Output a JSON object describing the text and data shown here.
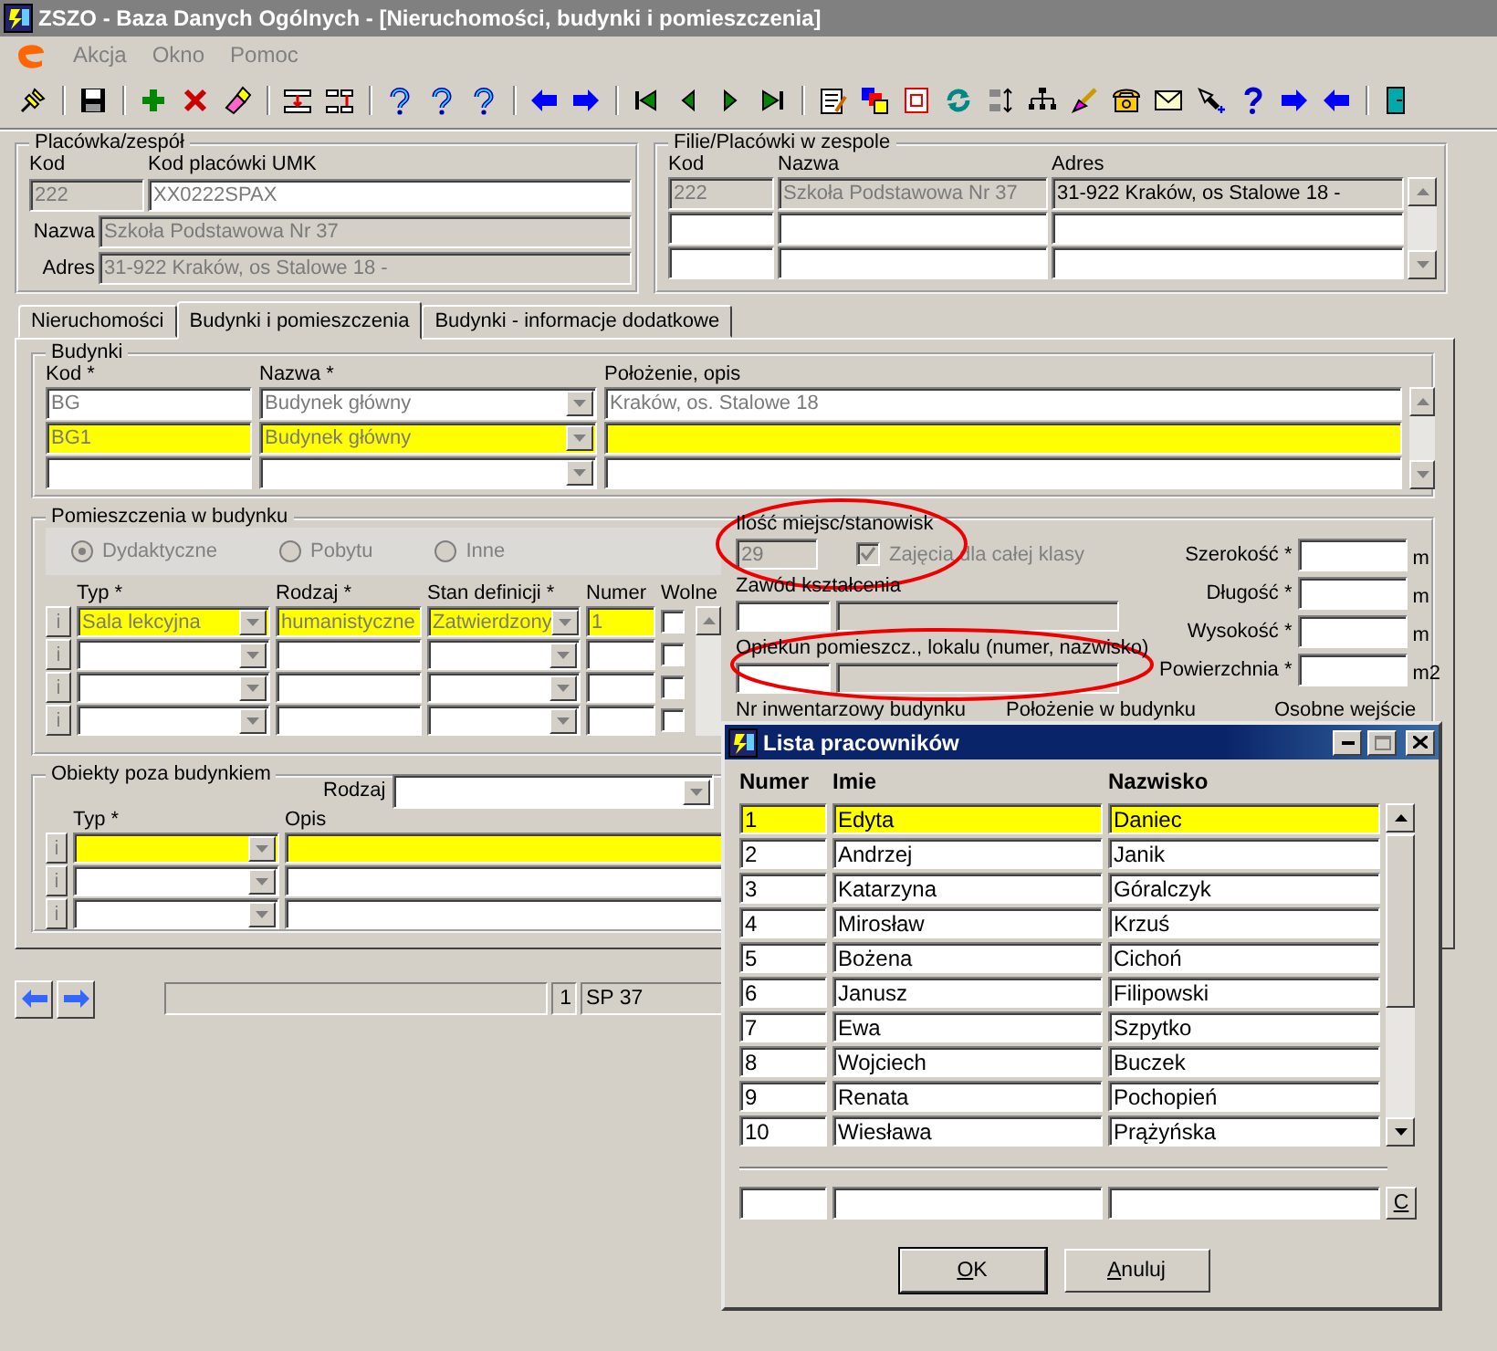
{
  "window": {
    "title": "ZSZO - Baza Danych Ogólnych - [Nieruchomości, budynki i pomieszczenia]"
  },
  "menu": [
    {
      "label": "Akcja",
      "disabled": true
    },
    {
      "label": "Okno",
      "disabled": true
    },
    {
      "label": "Pomoc",
      "disabled": true
    }
  ],
  "placowka": {
    "title": "Placówka/zespół",
    "kod_label": "Kod",
    "kod": "222",
    "umk_label": "Kod placówki UMK",
    "umk": "XX0222SPAX",
    "nazwa_label": "Nazwa",
    "nazwa": "Szkoła Podstawowa Nr  37",
    "adres_label": "Adres",
    "adres": "31-922 Kraków, os Stalowe 18 -"
  },
  "filie": {
    "title": "Filie/Placówki w zespole",
    "columns": [
      "Kod",
      "Nazwa",
      "Adres"
    ],
    "rows": [
      {
        "kod": "222",
        "nazwa": "Szkoła Podstawowa Nr  37",
        "adres": "31-922 Kraków, os Stalowe 18 -"
      },
      {},
      {}
    ]
  },
  "tabs": [
    {
      "label": "Nieruchomości",
      "selected": false
    },
    {
      "label": "Budynki i pomieszczenia",
      "selected": true
    },
    {
      "label": "Budynki - informacje dodatkowe",
      "selected": false
    }
  ],
  "budynki": {
    "title": "Budynki",
    "columns": [
      "Kod *",
      "Nazwa *",
      "Położenie, opis"
    ],
    "rows": [
      {
        "kod": "BG",
        "nazwa": "Budynek główny",
        "opis": "Kraków, os. Stalowe 18",
        "selected": false
      },
      {
        "kod": "BG1",
        "nazwa": "Budynek główny",
        "selected": true
      },
      {
        "selected": false
      }
    ]
  },
  "pomieszczenia": {
    "title": "Pomieszczenia w budynku",
    "radios": [
      {
        "label": "Dydaktyczne",
        "selected": true,
        "disabled": true
      },
      {
        "label": "Pobytu",
        "selected": false,
        "disabled": true
      },
      {
        "label": "Inne",
        "selected": false,
        "disabled": true
      }
    ],
    "columns": [
      "Typ *",
      "Rodzaj *",
      "Stan definicji *",
      "Numer",
      "Wolne"
    ],
    "rows": [
      {
        "info": "i",
        "typ": "Sala lekcyjna",
        "rodzaj": "humanistyczne",
        "stan": "Zatwierdzony",
        "numer": "1",
        "wolne": false,
        "selected": true
      },
      {
        "info": "i",
        "wolne": false,
        "selected": false
      },
      {
        "info": "i",
        "wolne": false,
        "selected": false
      },
      {
        "info": "i",
        "wolne": false,
        "selected": false
      }
    ],
    "miejsca_label": "Ilość miejsc/stanowisk",
    "miejsca": "29",
    "cala_klasa": {
      "label": "Zajęcia dla całej klasy",
      "checked": true,
      "disabled": true
    },
    "zawod_label": "Zawód kształcenia",
    "opiekun_label": "Opiekun pomieszcz., lokalu (numer, nazwisko)",
    "dims": [
      {
        "label": "Szerokość *",
        "unit": "m"
      },
      {
        "label": "Długość *",
        "unit": "m"
      },
      {
        "label": "Wysokość *",
        "unit": "m"
      },
      {
        "label": "Powierzchnia *",
        "unit": "m2"
      }
    ],
    "bottom_labels": [
      "Nr inwentarzowy budynku",
      "Położenie w budynku",
      "Osobne wejście"
    ]
  },
  "obiekty": {
    "title": "Obiekty poza budynkiem",
    "rodzaj_label": "Rodzaj",
    "columns": [
      "Typ *",
      "Opis"
    ],
    "rows": [
      {
        "info": "i",
        "selected": true
      },
      {
        "info": "i",
        "selected": false
      },
      {
        "info": "i",
        "selected": false
      }
    ]
  },
  "status": {
    "number": "1",
    "name": "SP 37"
  },
  "dialog": {
    "title": "Lista pracowników",
    "columns": [
      "Numer",
      "Imie",
      "Nazwisko"
    ],
    "rows": [
      {
        "numer": "1",
        "imie": "Edyta",
        "nazwisko": "Daniec",
        "selected": true
      },
      {
        "numer": "2",
        "imie": "Andrzej",
        "nazwisko": "Janik",
        "selected": false
      },
      {
        "numer": "3",
        "imie": "Katarzyna",
        "nazwisko": "Góralczyk",
        "selected": false
      },
      {
        "numer": "4",
        "imie": "Mirosław",
        "nazwisko": "Krzuś",
        "selected": false
      },
      {
        "numer": "5",
        "imie": "Bożena",
        "nazwisko": "Cichoń",
        "selected": false
      },
      {
        "numer": "6",
        "imie": "Janusz",
        "nazwisko": "Filipowski",
        "selected": false
      },
      {
        "numer": "7",
        "imie": "Ewa",
        "nazwisko": "Szpytko",
        "selected": false
      },
      {
        "numer": "8",
        "imie": "Wojciech",
        "nazwisko": "Buczek",
        "selected": false
      },
      {
        "numer": "9",
        "imie": "Renata",
        "nazwisko": "Pochopień",
        "selected": false
      },
      {
        "numer": "10",
        "imie": "Wiesława",
        "nazwisko": "Prążyńska",
        "selected": false
      }
    ],
    "clear_button": "C",
    "buttons": [
      {
        "label": "OK",
        "default": true
      },
      {
        "label": "Anuluj",
        "default": false
      }
    ]
  }
}
